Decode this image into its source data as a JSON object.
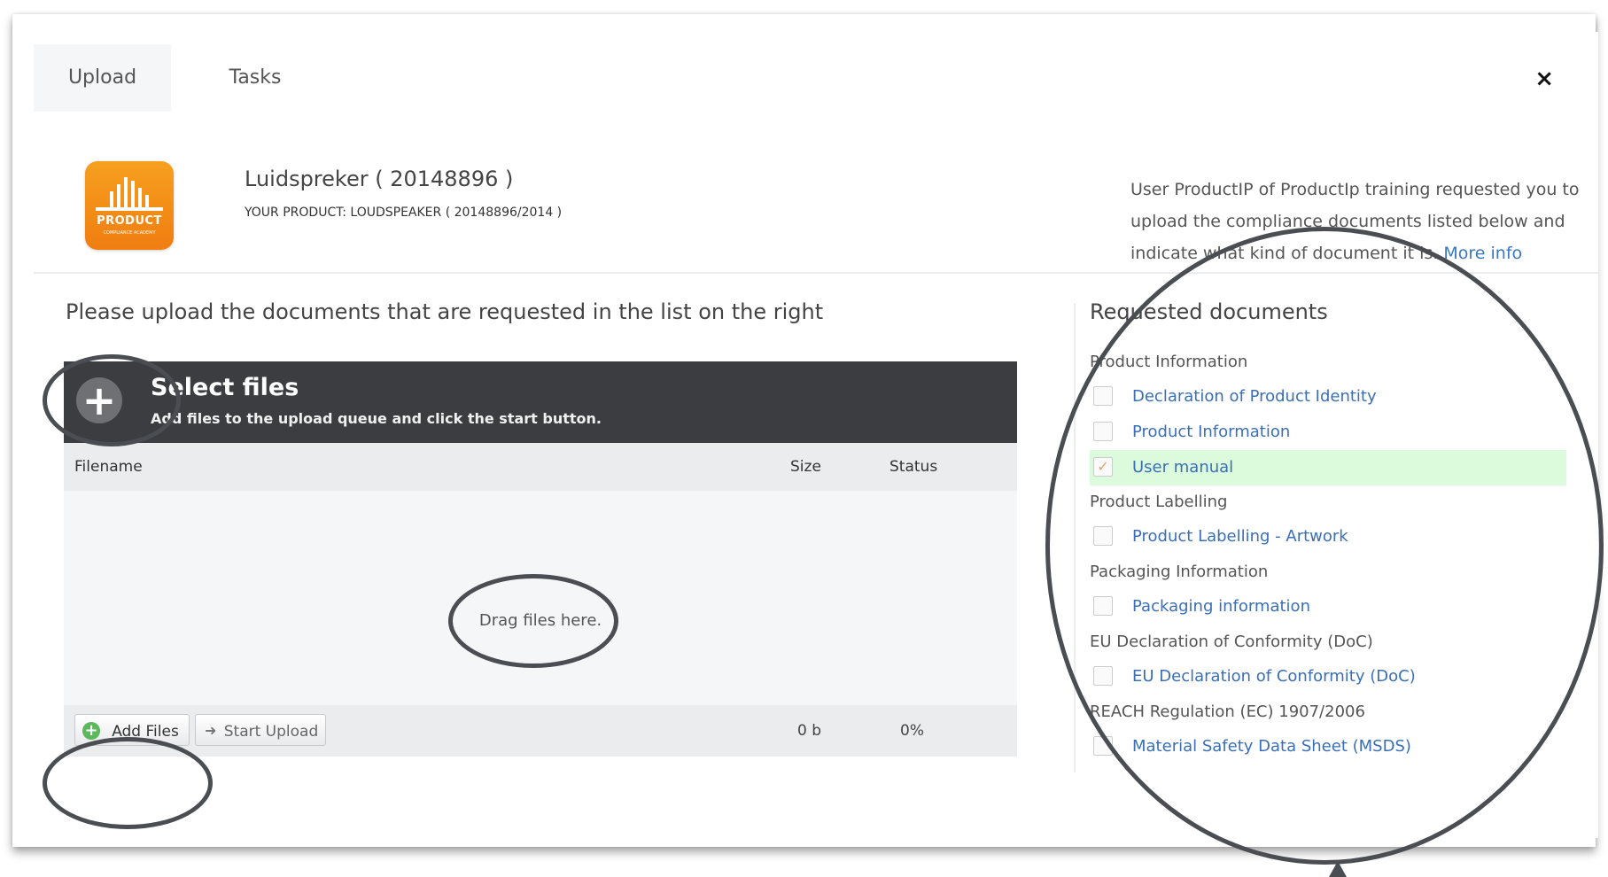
{
  "tabs": [
    {
      "label": "Upload",
      "active": true
    },
    {
      "label": "Tasks",
      "active": false
    }
  ],
  "close_icon": "×",
  "product": {
    "logo_word": "PRODUCT",
    "logo_sub": "COMPLIANCE ACADEMY",
    "title": "Luidspreker ( 20148896 )",
    "subtitle": "YOUR PRODUCT: LOUDSPEAKER ( 20148896/2014 )"
  },
  "info": {
    "text": "User ProductIP of ProductIp training requested you to upload the compliance documents listed below and indicate what kind of document it is.",
    "link": "More info"
  },
  "upload": {
    "heading": "Please upload the documents that are requested in the list on the right",
    "header_title": "Select files",
    "header_desc": "Add files to the upload queue and click the start button.",
    "columns": {
      "filename": "Filename",
      "size": "Size",
      "status": "Status"
    },
    "drag_text": "Drag files here.",
    "add_button": "Add Files",
    "start_button": "Start Upload",
    "total_size": "0 b",
    "total_status": "0%"
  },
  "requested": {
    "title": "Requested documents",
    "groups": [
      {
        "name": "Product Information",
        "items": [
          {
            "label": "Declaration of Product Identity",
            "checked": false
          },
          {
            "label": "Product Information",
            "checked": false
          },
          {
            "label": "User manual",
            "checked": true
          }
        ]
      },
      {
        "name": "Product Labelling",
        "items": [
          {
            "label": "Product Labelling - Artwork",
            "checked": false
          }
        ]
      },
      {
        "name": "Packaging Information",
        "items": [
          {
            "label": "Packaging information",
            "checked": false
          }
        ]
      },
      {
        "name": "EU Declaration of Conformity (DoC)",
        "items": [
          {
            "label": "EU Declaration of Conformity (DoC)",
            "checked": false
          }
        ]
      },
      {
        "name": "REACH Regulation (EC) 1907/2006",
        "items": [
          {
            "label": "Material Safety Data Sheet (MSDS)",
            "checked": false
          }
        ]
      }
    ]
  },
  "colors": {
    "header_dark": "#3b3d41",
    "accent_orange": "#f07d10",
    "link_blue": "#3a6fb6",
    "checked_row": "#dcfbdc",
    "add_green": "#5cb85c",
    "annotation": "#4a4d52"
  }
}
